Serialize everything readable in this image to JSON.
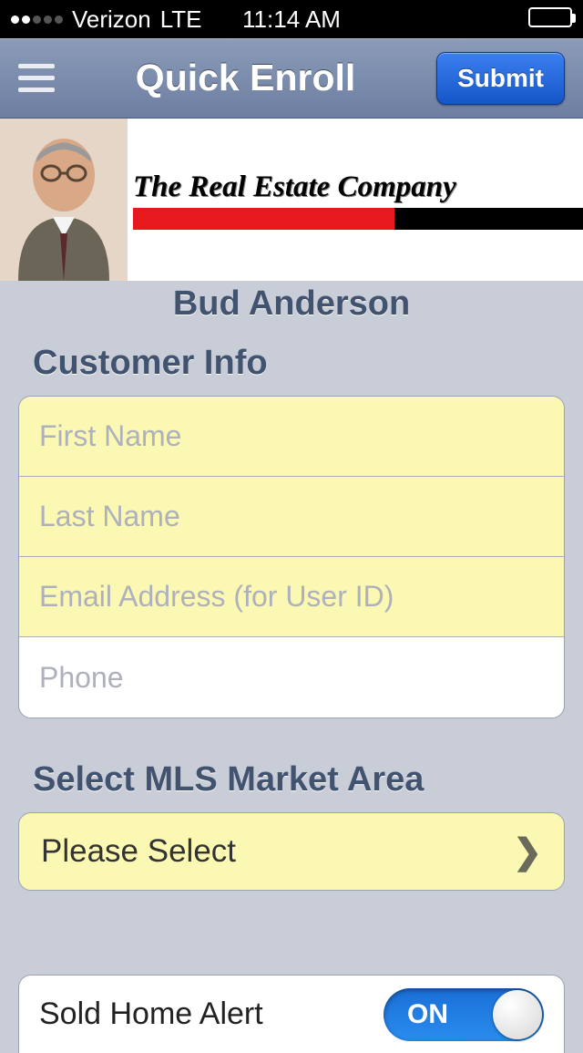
{
  "statusbar": {
    "carrier": "Verizon",
    "network": "LTE",
    "time": "11:14 AM"
  },
  "nav": {
    "title": "Quick Enroll",
    "submit_label": "Submit"
  },
  "company": {
    "name": "The Real Estate Company",
    "agent_name": "Bud Anderson"
  },
  "customer": {
    "section_label": "Customer Info",
    "first_name_placeholder": "First Name",
    "last_name_placeholder": "Last Name",
    "email_placeholder": "Email Address (for User ID)",
    "phone_placeholder": "Phone"
  },
  "mls": {
    "section_label": "Select MLS Market Area",
    "selected": "Please Select"
  },
  "alert": {
    "label": "Sold Home Alert",
    "toggle_text": "ON",
    "enabled": true
  }
}
